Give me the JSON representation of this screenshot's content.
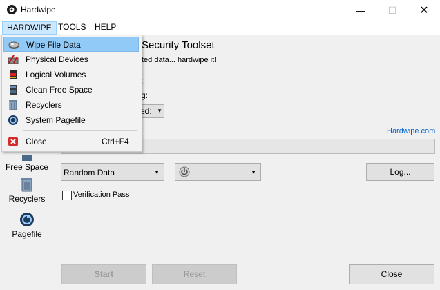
{
  "window": {
    "title": "Hardwipe",
    "minimize": "—",
    "maximize": "☐",
    "close": "✕"
  },
  "menubar": {
    "items": [
      "HARDWIPE",
      "TOOLS",
      "HELP"
    ]
  },
  "menu": {
    "items": [
      {
        "label": "Wipe File Data",
        "icon": "wipe-file-icon",
        "selected": true
      },
      {
        "label": "Physical Devices",
        "icon": "physical-devices-icon"
      },
      {
        "label": "Logical Volumes",
        "icon": "logical-volumes-icon"
      },
      {
        "label": "Clean Free Space",
        "icon": "clean-free-space-icon"
      },
      {
        "label": "Recyclers",
        "icon": "recycler-icon"
      },
      {
        "label": "System Pagefile",
        "icon": "pagefile-icon"
      }
    ],
    "close": {
      "label": "Close",
      "shortcut": "Ctrl+F4",
      "icon": "close-icon"
    }
  },
  "sidebar": {
    "items": [
      {
        "label": "Free Space",
        "icon": "free-space-icon"
      },
      {
        "label": "Recyclers",
        "icon": "recycler-icon"
      },
      {
        "label": "Pagefile",
        "icon": "pagefile-icon"
      }
    ]
  },
  "main": {
    "heading_fragment": "Security Toolset",
    "tagline_fragment": "ted data... hardwipe it!",
    "field_fragment_a": ":",
    "field_fragment_b": "g:",
    "combo_fragment": "ed:",
    "link": "Hardwipe.com",
    "method_combo": "Random Data",
    "passes_combo_icon": "power-icon",
    "log_button": "Log...",
    "verification_label": "Verification Pass",
    "verification_checked": false,
    "start_button": "Start",
    "reset_button": "Reset",
    "close_button": "Close"
  },
  "colors": {
    "accent": "#cce8ff",
    "selected": "#91c9f7",
    "link": "#0066cc"
  }
}
